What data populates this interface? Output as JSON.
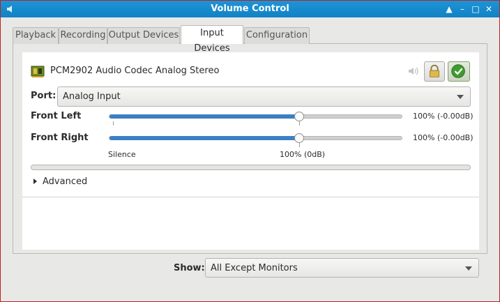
{
  "window": {
    "title": "Volume Control"
  },
  "tabs": [
    {
      "label": "Playback"
    },
    {
      "label": "Recording"
    },
    {
      "label": "Output Devices"
    },
    {
      "label": "Input Devices",
      "active": true
    },
    {
      "label": "Configuration"
    }
  ],
  "device": {
    "name": "PCM2902 Audio Codec Analog Stereo",
    "port_label": "Port:",
    "port_value": "Analog Input",
    "channels": [
      {
        "label": "Front Left",
        "volume_fraction": 0.65,
        "value_text": "100% (-0.00dB)"
      },
      {
        "label": "Front Right",
        "volume_fraction": 0.65,
        "value_text": "100% (-0.00dB)"
      }
    ],
    "scale_marks": {
      "silence": "Silence",
      "normal": "100% (0dB)"
    },
    "peak_level": 0,
    "advanced_label": "Advanced"
  },
  "footer": {
    "show_label": "Show:",
    "show_value": "All Except Monitors"
  },
  "colors": {
    "titlebar": "#1282c4",
    "slider_fill": "#3c7fc2",
    "default_check": "#3f9b2f",
    "window_border": "#c0201e"
  }
}
